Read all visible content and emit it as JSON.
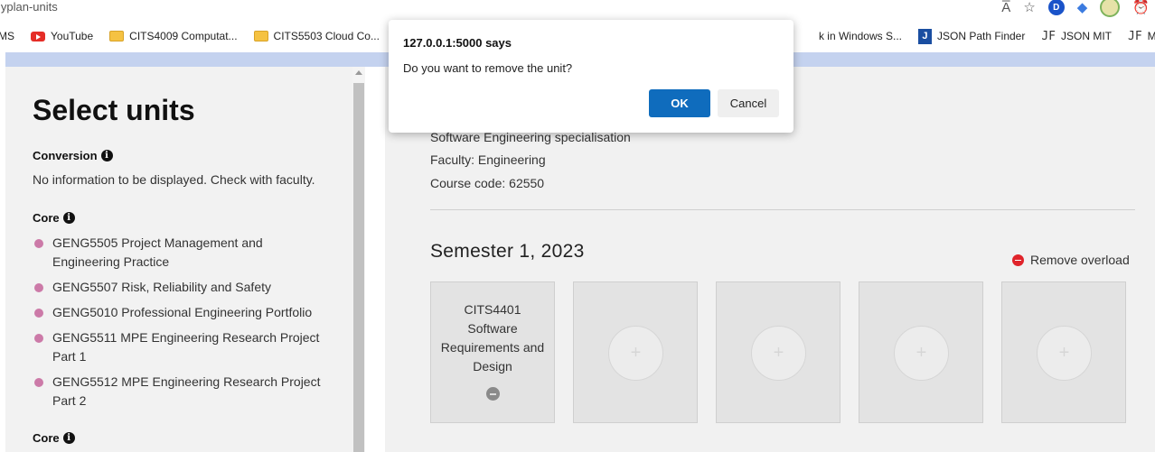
{
  "browser": {
    "url": "lyplan-units",
    "icons": [
      "read-aloud-icon",
      "add-favorite-icon",
      "profile-icon",
      "extension-icon",
      "avatar-icon",
      "alarm-icon"
    ],
    "profile_letter": "D",
    "read_aloud_glyph": "A̅",
    "bookmarks": [
      {
        "label": "MS",
        "icon": "none"
      },
      {
        "label": "YouTube",
        "icon": "youtube-icon"
      },
      {
        "label": "CITS4009 Computat...",
        "icon": "folder-icon"
      },
      {
        "label": "CITS5503 Cloud Co...",
        "icon": "folder-icon"
      },
      {
        "label": "k in Windows S...",
        "icon": "folder-icon"
      },
      {
        "label": "JSON Path Finder",
        "icon": "json-path-icon"
      },
      {
        "label": "JSON MIT",
        "icon": "jf-icon"
      },
      {
        "label": "MASTER",
        "icon": "jf-icon"
      }
    ],
    "jf_glyph": "JF",
    "j_glyph": "J"
  },
  "sidebar": {
    "title": "Select units",
    "conversion_heading": "Conversion",
    "conversion_note": "No information to be displayed. Check with faculty.",
    "core_heading": "Core",
    "core_units": [
      "GENG5505 Project Management and Engineering Practice",
      "GENG5507 Risk, Reliability and Safety",
      "GENG5010 Professional Engineering Portfolio",
      "GENG5511 MPE Engineering Research Project Part 1",
      "GENG5512 MPE Engineering Research Project Part 2"
    ],
    "core_heading_2": "Core",
    "info_glyph": "i"
  },
  "main": {
    "specialisation": "Software Engineering specialisation",
    "faculty": "Faculty: Engineering",
    "course_code": "Course code: 62550",
    "semester_title": "Semester 1, 2023",
    "remove_overload": "Remove overload",
    "plus_glyph": "+",
    "cards": [
      {
        "text": "CITS4401 Software Requirements and Design"
      }
    ]
  },
  "dialog": {
    "title": "127.0.0.1:5000 says",
    "message": "Do you want to remove the unit?",
    "ok": "OK",
    "cancel": "Cancel"
  },
  "colors": {
    "accent": "#0f6cbd",
    "bullet": "#cc7aa8",
    "remove_red": "#e0242b",
    "header_strip": "#c4d2ef"
  }
}
